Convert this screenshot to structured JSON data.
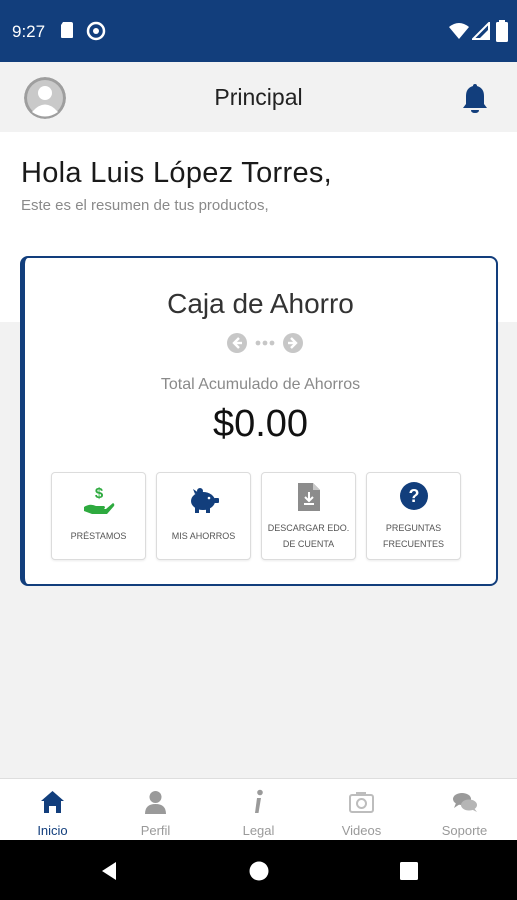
{
  "status_bar": {
    "time": "9:27"
  },
  "app_bar": {
    "title": "Principal"
  },
  "greeting": {
    "hello": "Hola Luis López Torres,",
    "subtitle": "Este es el resumen de tus productos,"
  },
  "card": {
    "title": "Caja de Ahorro",
    "total_label": "Total Acumulado de Ahorros",
    "amount": "$0.00",
    "tiles": [
      {
        "line1": "PRÉSTAMOS",
        "line2": "",
        "icon": "hand-money-icon",
        "color": "#2eaa3f"
      },
      {
        "line1": "MIS AHORROS",
        "line2": "",
        "icon": "piggy-bank-icon",
        "color": "#123e7c"
      },
      {
        "line1": "DESCARGAR EDO.",
        "line2": "DE CUENTA",
        "icon": "download-file-icon",
        "color": "#8c8c8c"
      },
      {
        "line1": "PREGUNTAS",
        "line2": "FRECUENTES",
        "icon": "question-circle-icon",
        "color": "#123e7c"
      }
    ]
  },
  "bottom_nav": [
    {
      "label": "Inicio",
      "icon": "home-icon",
      "active": true
    },
    {
      "label": "Perfil",
      "icon": "user-icon",
      "active": false
    },
    {
      "label": "Legal",
      "icon": "info-icon",
      "active": false
    },
    {
      "label": "Videos",
      "icon": "camera-icon",
      "active": false
    },
    {
      "label": "Soporte",
      "icon": "chat-icon",
      "active": false
    }
  ],
  "colors": {
    "primary": "#123e7c",
    "accent_green": "#2eaa3f",
    "background": "#f2f2f2"
  }
}
